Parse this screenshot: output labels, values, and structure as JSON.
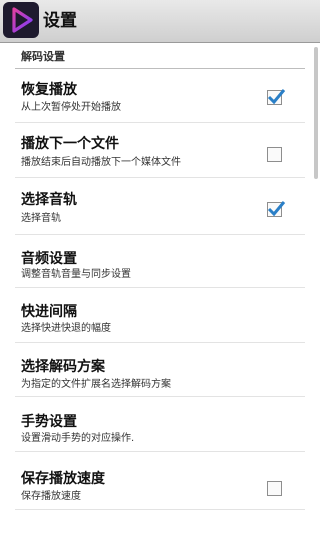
{
  "app": {
    "title": "设置",
    "icon": "play-icon"
  },
  "section": {
    "title": "解码设置"
  },
  "items": [
    {
      "title": "恢复播放",
      "summary": "从上次暂停处开始播放",
      "checkbox": true,
      "checked": true
    },
    {
      "title": "播放下一个文件",
      "summary": "播放结束后自动播放下一个媒体文件",
      "checkbox": true,
      "checked": false
    },
    {
      "title": "选择音轨",
      "summary": "选择音轨",
      "checkbox": true,
      "checked": true
    },
    {
      "title": "音频设置",
      "summary": "调整音轨音量与同步设置",
      "checkbox": false
    },
    {
      "title": "快进间隔",
      "summary": "选择快进快退的幅度",
      "checkbox": false
    },
    {
      "title": "选择解码方案",
      "summary": "为指定的文件扩展名选择解码方案",
      "checkbox": false
    },
    {
      "title": "手势设置",
      "summary": "设置滑动手势的对应操作.",
      "checkbox": false
    },
    {
      "title": "保存播放速度",
      "summary": "保存播放速度",
      "checkbox": true,
      "checked": false
    }
  ],
  "colors": {
    "check": "#2a7fc7",
    "titlebar": "#dcdcdc",
    "icon_bg": "#1e1a2e"
  }
}
